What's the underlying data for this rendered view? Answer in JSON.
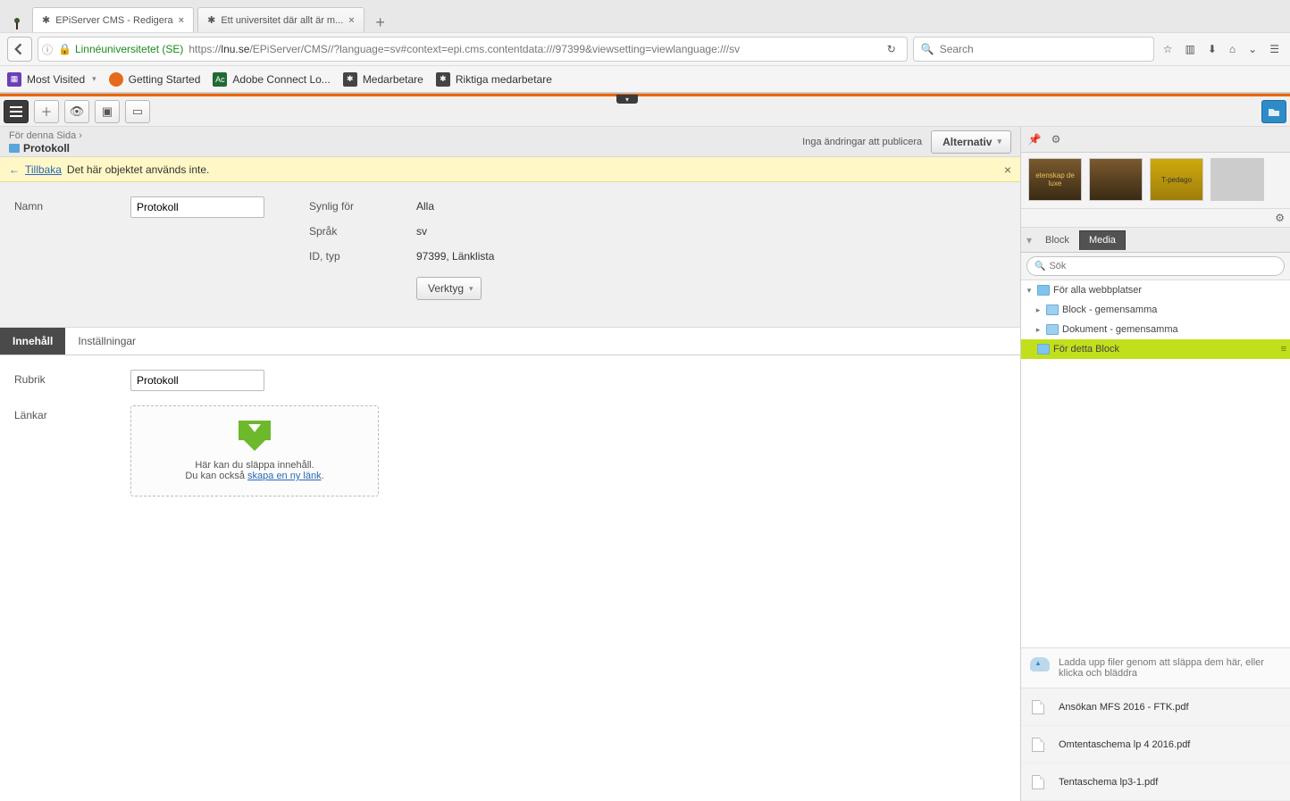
{
  "browser": {
    "tabs": [
      {
        "label": "EPiServer CMS - Redigera"
      },
      {
        "label": "Ett universitet där allt är m..."
      }
    ],
    "identity": "Linnéuniversitetet (SE)",
    "url_prefix": "https://",
    "url_host": "lnu.se",
    "url_path": "/EPiServer/CMS//?language=sv#context=epi.cms.contentdata:///97399&viewsetting=viewlanguage:///sv",
    "search_placeholder": "Search",
    "bookmarks": [
      {
        "label": "Most Visited",
        "hasMenu": true,
        "iconColor": "#6a3fb6"
      },
      {
        "label": "Getting Started",
        "iconColor": "#e66a1c"
      },
      {
        "label": "Adobe Connect Lo...",
        "iconColor": "#1f6b32"
      },
      {
        "label": "Medarbetare",
        "iconColor": "#555"
      },
      {
        "label": "Riktiga medarbetare",
        "iconColor": "#555"
      }
    ]
  },
  "breadcrumb": {
    "context": "För denna Sida",
    "title": "Protokoll"
  },
  "publish": {
    "status": "Inga ändringar att publicera",
    "alt_label": "Alternativ"
  },
  "notice": {
    "back_label": "Tillbaka",
    "text": "Det här objektet används inte."
  },
  "properties": {
    "name_label": "Namn",
    "name_value": "Protokoll",
    "visible_label": "Synlig för",
    "visible_value": "Alla",
    "lang_label": "Språk",
    "lang_value": "sv",
    "idtype_label": "ID, typ",
    "idtype_value": "97399, Länklista",
    "tools_label": "Verktyg"
  },
  "edit_tabs": {
    "content": "Innehåll",
    "settings": "Inställningar"
  },
  "content_form": {
    "rubrik_label": "Rubrik",
    "rubrik_value": "Protokoll",
    "links_label": "Länkar",
    "dropzone_line1": "Här kan du släppa innehåll.",
    "dropzone_line2a": "Du kan också ",
    "dropzone_link": "skapa en ny länk",
    "dropzone_period": "."
  },
  "side": {
    "tabs": {
      "block": "Block",
      "media": "Media"
    },
    "search_placeholder": "Sök",
    "tree": {
      "root": "För alla webbplatser",
      "n1": "Block - gemensamma",
      "n2": "Dokument - gemensamma",
      "n3": "För detta Block"
    },
    "upload_hint": "Ladda upp filer genom att släppa dem här, eller klicka och bläddra",
    "files": [
      "Ansökan MFS 2016 - FTK.pdf",
      "Omtentaschema lp 4 2016.pdf",
      "Tentaschema lp3-1.pdf"
    ],
    "thumbs": [
      "etenskap de luxe",
      "",
      "T-pedago",
      ""
    ]
  }
}
